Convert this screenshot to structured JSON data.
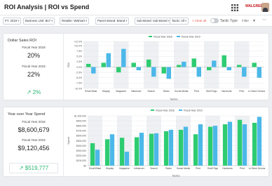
{
  "header": {
    "title": "ROI Analysis | ROI vs Spend",
    "brand_logo": "WALGREENS",
    "icons": {
      "grid": "grid-icon",
      "avatar": "user-avatar"
    }
  },
  "filters": {
    "chips": [
      {
        "label": "FY: 2019"
      },
      {
        "label": "Business Unit: BLT"
      },
      {
        "label": "Retailer: Walmart"
      },
      {
        "label": "Parent Brand: Brand"
      },
      {
        "label": "Sub-Brand: Sub-Brand"
      },
      {
        "label": "Tactic: All"
      }
    ],
    "clear_all": "× Clear all",
    "toggle_label": "Tactic Type",
    "filter_label": "Filter",
    "icons": {
      "filter": "filter-icon",
      "more": "more-icon"
    }
  },
  "roi_panel": {
    "title": "Dollar Sales ROI",
    "fy2018_label": "Fiscal Year 2018",
    "fy2018_value": "20%",
    "fy2019_label": "Fiscal Year 2019",
    "fy2019_value": "22%",
    "change": "↗ 2%"
  },
  "spend_panel": {
    "title": "Year over Year Spend",
    "fy2018_label": "Fiscal Year 2018",
    "fy2018_value": "$8,600,679",
    "fy2019_label": "Fiscal Year 2019",
    "fy2019_value": "$9,120,456",
    "change": "↗ $519,777"
  },
  "colors": {
    "fy2018": "#2ecc71",
    "fy2019": "#4cb8e8",
    "positive": "#2bb673",
    "band": "#eef0f3"
  },
  "chart_data": [
    {
      "type": "bar",
      "categories": [
        "Email Blast",
        "Display",
        "Magazine",
        "Influencer",
        "Search",
        "Radio",
        "Social Media",
        "Print",
        "Shelf Sign",
        "Handouts",
        "Print",
        "In-Store Demos"
      ],
      "series": [
        {
          "name": "Fiscal Year 2018",
          "values": [
            1.5,
            2.0,
            -2.5,
            2.0,
            3.5,
            -3.0,
            1.0,
            4.0,
            -1.5,
            5.5,
            1.0,
            2.0
          ]
        },
        {
          "name": "Fiscal Year 2019",
          "values": [
            -3.0,
            6.5,
            8.5,
            -1.5,
            -4.5,
            -5.5,
            2.5,
            -4.5,
            3.0,
            -1.5,
            -4.5,
            -5.0
          ]
        }
      ],
      "xlabel": "Tactics",
      "ylabel": "ROI",
      "ylim": [
        -10,
        12
      ],
      "yticks": [
        -10,
        -7.5,
        -5,
        -2.5,
        0,
        2.5,
        5,
        7.5,
        10,
        12
      ],
      "ytick_labels": [
        "-10.0%",
        "-7.5%",
        "-5.0%",
        "-2.5%",
        "0.0%",
        "2.5%",
        "5.0%",
        "7.5%",
        "+10.0%",
        "+12.0%"
      ],
      "legend": "top-center"
    },
    {
      "type": "bar",
      "categories": [
        "Email Blast",
        "Display",
        "Magazine",
        "Influencer",
        "Search",
        "Radio",
        "Social Media",
        "Print",
        "Shelf Sign",
        "Handouts",
        "Print",
        "In-Store Demos"
      ],
      "series": [
        {
          "name": "Fiscal Year 2018",
          "values": [
            450000,
            530000,
            560000,
            570000,
            640000,
            690000,
            720000,
            630000,
            780000,
            830000,
            920000,
            860000
          ]
        },
        {
          "name": "Fiscal Year 2019",
          "values": [
            320000,
            630000,
            280000,
            660000,
            650000,
            720000,
            780000,
            830000,
            800000,
            880000,
            830000,
            980000
          ]
        }
      ],
      "xlabel": "Tactics",
      "ylabel": "Spend",
      "ylim": [
        0,
        1000000
      ],
      "yticks": [
        0,
        100000,
        200000,
        300000,
        400000,
        500000,
        600000,
        700000,
        800000,
        900000,
        1000000
      ],
      "ytick_labels": [
        "$0",
        "$100,000",
        "$200,000",
        "$300,000",
        "$400,000",
        "$500,000",
        "$600,000",
        "$700,000",
        "$800,000",
        "$900,000",
        "$1,000,000"
      ],
      "legend": "top-center"
    }
  ]
}
